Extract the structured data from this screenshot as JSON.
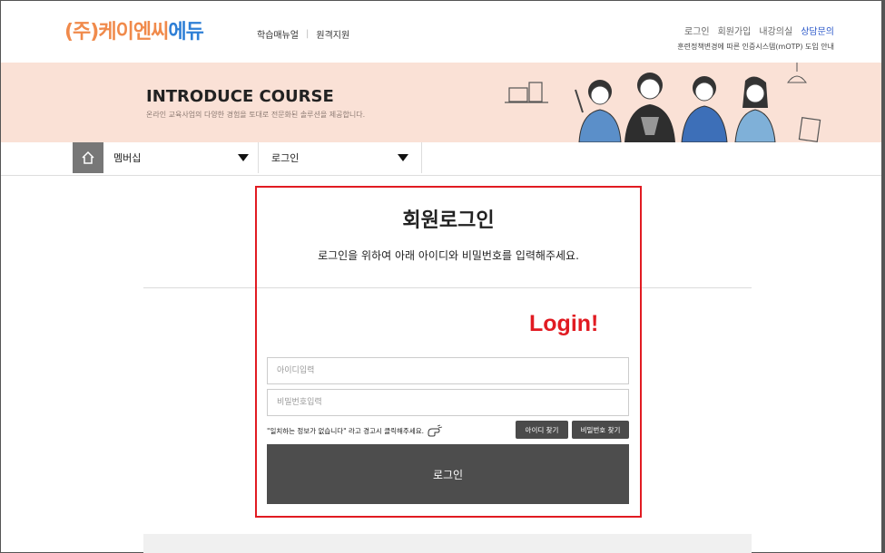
{
  "header": {
    "logo_prefix": "(주)",
    "logo_orange": "케이엔씨",
    "logo_blue": "에듀",
    "gnb": [
      "학습매뉴얼",
      "원격지원"
    ],
    "util_links": [
      "로그인",
      "회원가입",
      "내강의실"
    ],
    "util_highlight": "상담문의",
    "util_notice": "훈련정책변경에 따른 인증시스템(mOTP) 도입 안내"
  },
  "banner": {
    "title": "INTRODUCE COURSE",
    "subtitle": "온라인 교육사업의 다양한 경험을 토대로 전문화된 솔루션을 제공합니다."
  },
  "subnav": {
    "crumb_1": "멤버십",
    "crumb_2": "로그인"
  },
  "login": {
    "title": "회원로그인",
    "description": "로그인을 위하여 아래 아이디와 비밀번호를 입력해주세요.",
    "annotation": "Login!",
    "id_placeholder": "아이디입력",
    "pw_placeholder": "비밀번호입력",
    "notice": "\"일치하는 정보가 없습니다\" 라고 경고시 클릭해주세요.",
    "find_id": "아이디 찾기",
    "find_pw": "비밀번호 찾기",
    "submit": "로그인"
  },
  "colors": {
    "logo_orange": "#f08a4b",
    "logo_blue": "#2e7fd6",
    "banner_bg": "#fae1d6",
    "highlight_red": "#e11b22",
    "button_dark": "#4d4d4d"
  },
  "icons": {
    "home": "home-icon",
    "caret": "caret-down-icon",
    "hand": "pointing-hand-icon"
  }
}
